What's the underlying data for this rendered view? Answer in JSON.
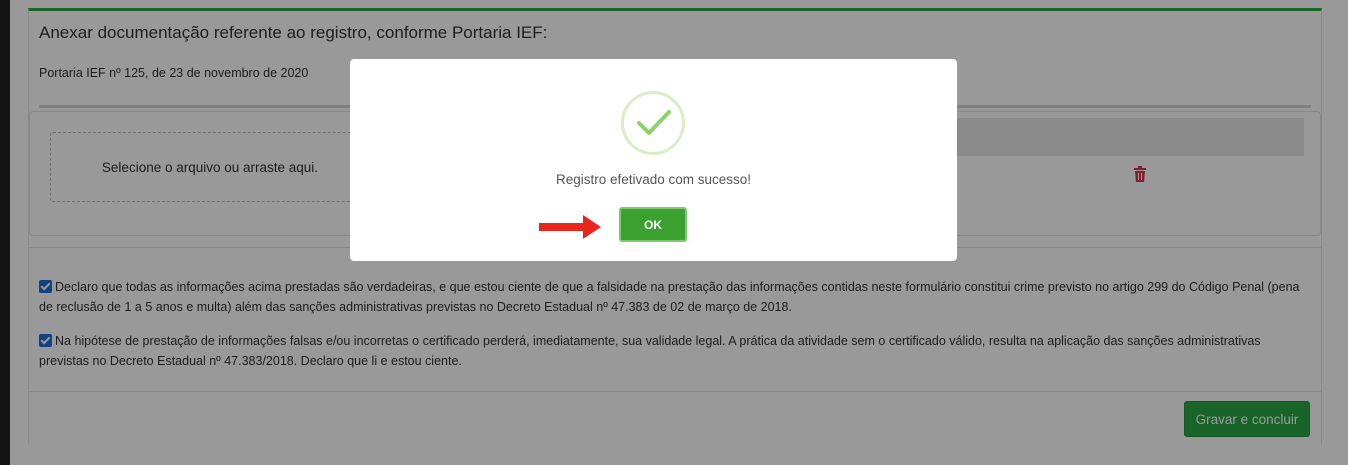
{
  "form": {
    "title": "Anexar documentação referente ao registro, conforme Portaria IEF:",
    "subtitle": "Portaria IEF nº 125, de 23 de novembro de 2020",
    "dropzone_text": "Selecione o arquivo ou arraste aqui.",
    "declaration_1": "Declaro que todas as informações acima prestadas são verdadeiras, e que estou ciente de que a falsidade na prestação das informações contidas neste formulário constitui crime previsto no artigo 299 do Código Penal (pena de reclusão de 1 a 5 anos e multa) além das sanções administrativas previstas no Decreto Estadual nº 47.383 de 02 de março de 2018.",
    "declaration_2": "Na hipótese de prestação de informações falsas e/ou incorretas o certificado perderá, imediatamente, sua validade legal. A prática da atividade sem o certificado válido, resulta na aplicação das sanções administrativas previstas no Decreto Estadual nº 47.383/2018. Declaro que li e estou ciente.",
    "declaration_1_checked": true,
    "declaration_2_checked": true,
    "save_label": "Gravar e concluir"
  },
  "modal": {
    "message": "Registro efetivado com sucesso!",
    "ok_label": "OK",
    "icon": "success-check-icon"
  },
  "colors": {
    "accent_green": "#28a745",
    "ok_green": "#3aa02f",
    "trash_red": "#dc3545",
    "arrow_red": "#e8261c",
    "checkbox_blue": "#1e6fd9"
  }
}
